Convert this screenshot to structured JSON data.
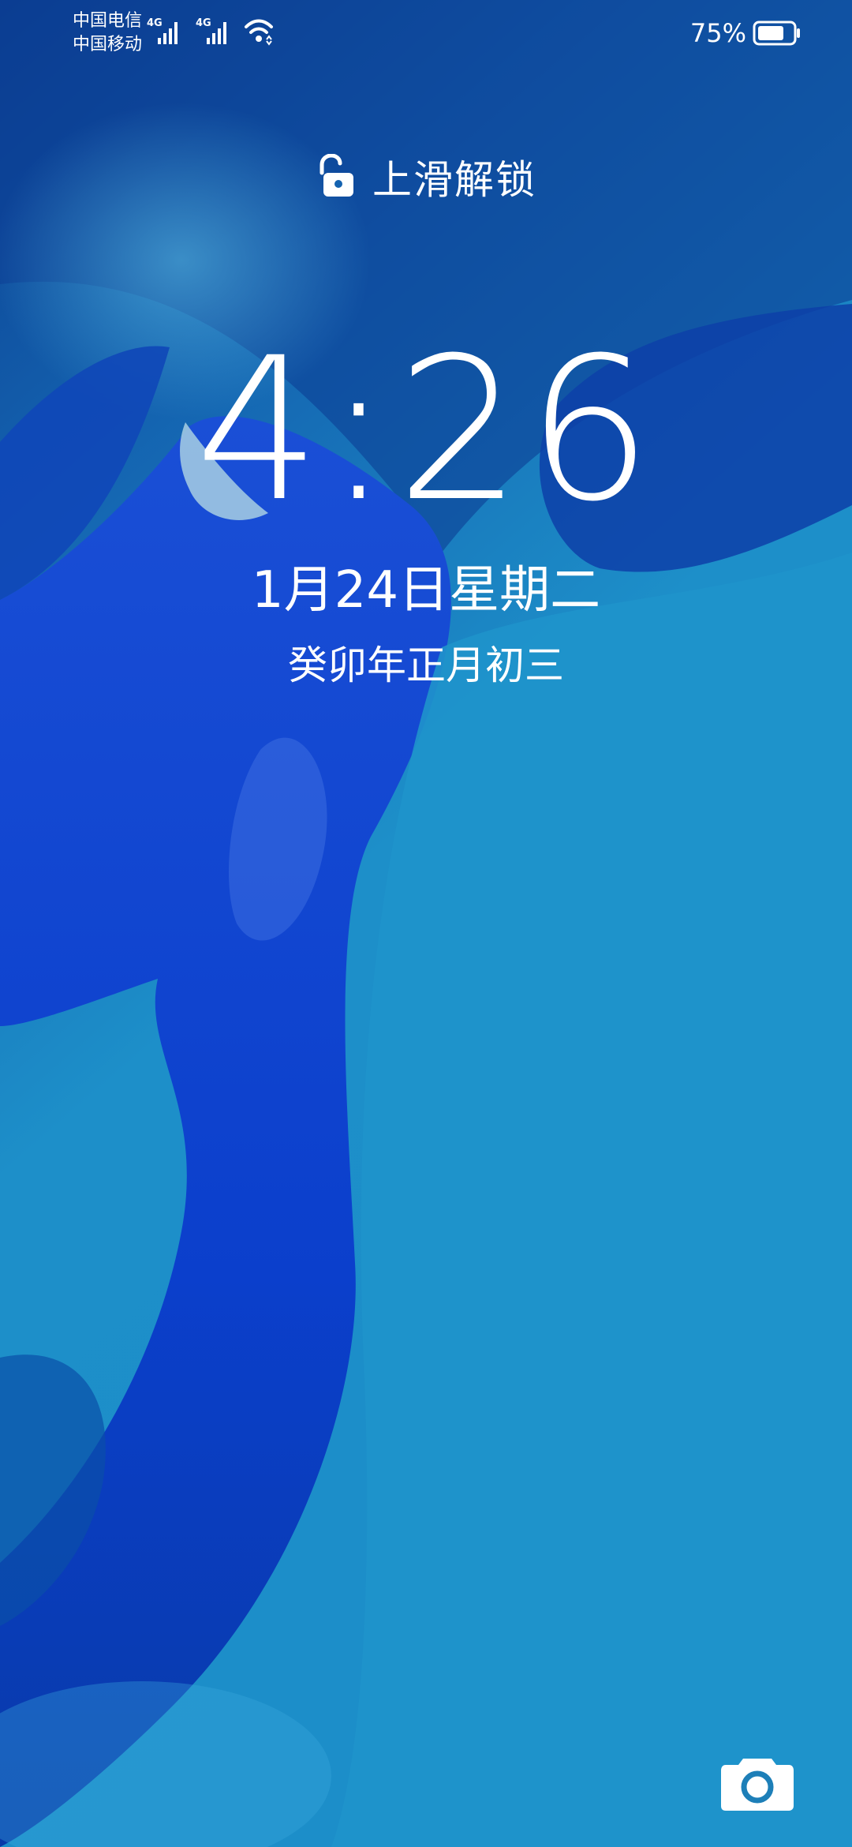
{
  "status_bar": {
    "carrier_1": "中国电信",
    "carrier_2": "中国移动",
    "sim1_network": "4G",
    "sim2_network": "4G",
    "battery_percent": "75%",
    "battery_level": 0.75,
    "icons": [
      "signal-icon",
      "wifi-icon",
      "battery-icon"
    ]
  },
  "lockscreen": {
    "unlock_hint": "上滑解锁",
    "time": "4:26",
    "date": "1月24日星期二",
    "lunar_date": "癸卯年正月初三"
  },
  "shortcuts": {
    "camera_icon": "camera-icon"
  },
  "colors": {
    "wallpaper_base": "#1b8ec8",
    "wallpaper_deep": "#0a2fb8",
    "text": "#ffffff"
  }
}
